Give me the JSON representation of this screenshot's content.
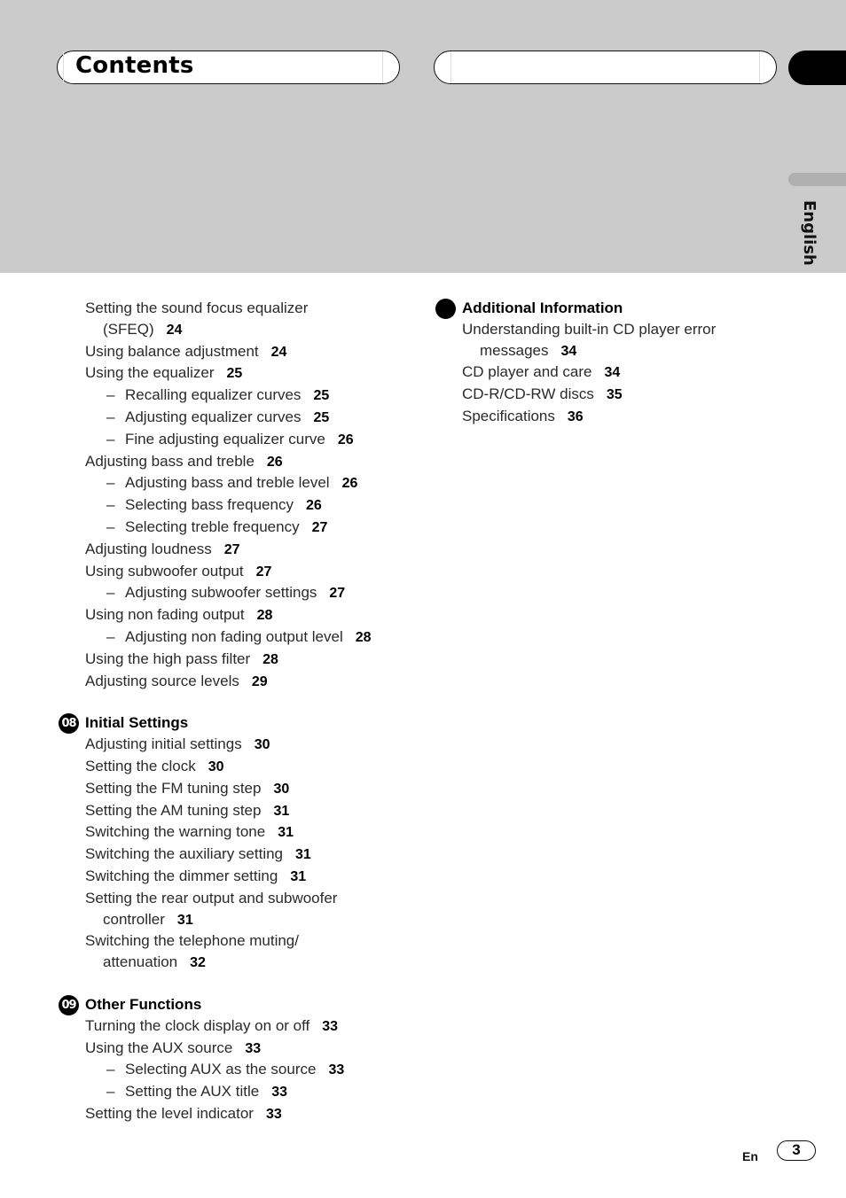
{
  "header": {
    "title": "Contents",
    "language_tab": "English"
  },
  "left_column": {
    "entries_before_sections": [
      {
        "text": "Setting the sound focus equalizer",
        "continuation": "(SFEQ)",
        "page": "24",
        "level": 0
      },
      {
        "text": "Using balance adjustment",
        "page": "24",
        "level": 0
      },
      {
        "text": "Using the equalizer",
        "page": "25",
        "level": 0
      },
      {
        "text": "Recalling equalizer curves",
        "page": "25",
        "level": 1
      },
      {
        "text": "Adjusting equalizer curves",
        "page": "25",
        "level": 1
      },
      {
        "text": "Fine adjusting equalizer curve",
        "page": "26",
        "level": 1
      },
      {
        "text": "Adjusting bass and treble",
        "page": "26",
        "level": 0
      },
      {
        "text": "Adjusting bass and treble level",
        "page": "26",
        "level": 1
      },
      {
        "text": "Selecting bass frequency",
        "page": "26",
        "level": 1
      },
      {
        "text": "Selecting treble frequency",
        "page": "27",
        "level": 1
      },
      {
        "text": "Adjusting loudness",
        "page": "27",
        "level": 0
      },
      {
        "text": "Using subwoofer output",
        "page": "27",
        "level": 0
      },
      {
        "text": "Adjusting subwoofer settings",
        "page": "27",
        "level": 1
      },
      {
        "text": "Using non fading output",
        "page": "28",
        "level": 0
      },
      {
        "text": "Adjusting non fading output level",
        "page": "28",
        "level": 1
      },
      {
        "text": "Using the high pass filter",
        "page": "28",
        "level": 0
      },
      {
        "text": "Adjusting source levels",
        "page": "29",
        "level": 0
      }
    ],
    "sections": [
      {
        "number": "08",
        "title": "Initial Settings",
        "entries": [
          {
            "text": "Adjusting initial settings",
            "page": "30",
            "level": 0
          },
          {
            "text": "Setting the clock",
            "page": "30",
            "level": 0
          },
          {
            "text": "Setting the FM tuning step",
            "page": "30",
            "level": 0
          },
          {
            "text": "Setting the AM tuning step",
            "page": "31",
            "level": 0
          },
          {
            "text": "Switching the warning tone",
            "page": "31",
            "level": 0
          },
          {
            "text": "Switching the auxiliary setting",
            "page": "31",
            "level": 0
          },
          {
            "text": "Switching the dimmer setting",
            "page": "31",
            "level": 0
          },
          {
            "text": "Setting the rear output and subwoofer",
            "continuation": "controller",
            "page": "31",
            "level": 0
          },
          {
            "text": "Switching the telephone muting/",
            "continuation": "attenuation",
            "page": "32",
            "level": 0
          }
        ]
      },
      {
        "number": "09",
        "title": "Other Functions",
        "entries": [
          {
            "text": "Turning the clock display on or off",
            "page": "33",
            "level": 0
          },
          {
            "text": "Using the AUX source",
            "page": "33",
            "level": 0
          },
          {
            "text": "Selecting AUX as the source",
            "page": "33",
            "level": 1
          },
          {
            "text": "Setting the AUX title",
            "page": "33",
            "level": 1
          },
          {
            "text": "Setting the level indicator",
            "page": "33",
            "level": 0
          }
        ]
      }
    ]
  },
  "right_column": {
    "sections": [
      {
        "number": "",
        "title": "Additional Information",
        "entries": [
          {
            "text": "Understanding built-in CD player error",
            "continuation": "messages",
            "page": "34",
            "level": 0
          },
          {
            "text": "CD player and care",
            "page": "34",
            "level": 0
          },
          {
            "text": "CD-R/CD-RW discs",
            "page": "35",
            "level": 0
          },
          {
            "text": "Specifications",
            "page": "36",
            "level": 0
          }
        ]
      }
    ]
  },
  "footer": {
    "language_code": "En",
    "page_number": "3"
  },
  "symbols": {
    "dash": "–"
  }
}
